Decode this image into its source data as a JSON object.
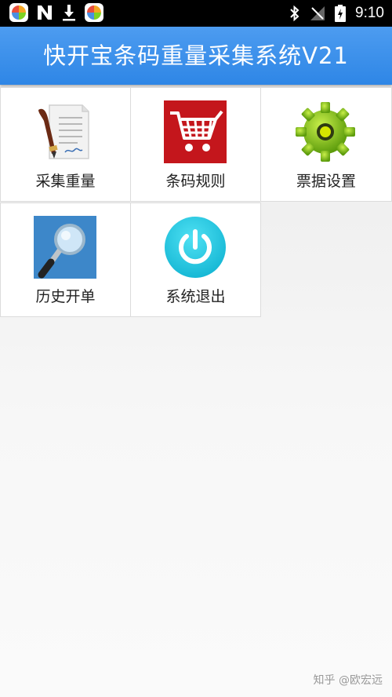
{
  "status_bar": {
    "time": "9:10",
    "left_icons": [
      "app-icon",
      "n-icon",
      "download-icon",
      "app-icon"
    ],
    "right_icons": [
      "bluetooth-icon",
      "signal-off-icon",
      "battery-charging-icon"
    ]
  },
  "app": {
    "title": "快开宝条码重量采集系统V21",
    "accent_color": "#2e86e6"
  },
  "menu": {
    "items": [
      {
        "label": "采集重量",
        "icon": "document-quill-icon"
      },
      {
        "label": "条码规则",
        "icon": "shopping-cart-icon"
      },
      {
        "label": "票据设置",
        "icon": "gear-icon"
      },
      {
        "label": "历史开单",
        "icon": "magnifier-icon"
      },
      {
        "label": "系统退出",
        "icon": "power-icon"
      }
    ]
  },
  "watermark": "知乎 @欧宏远"
}
